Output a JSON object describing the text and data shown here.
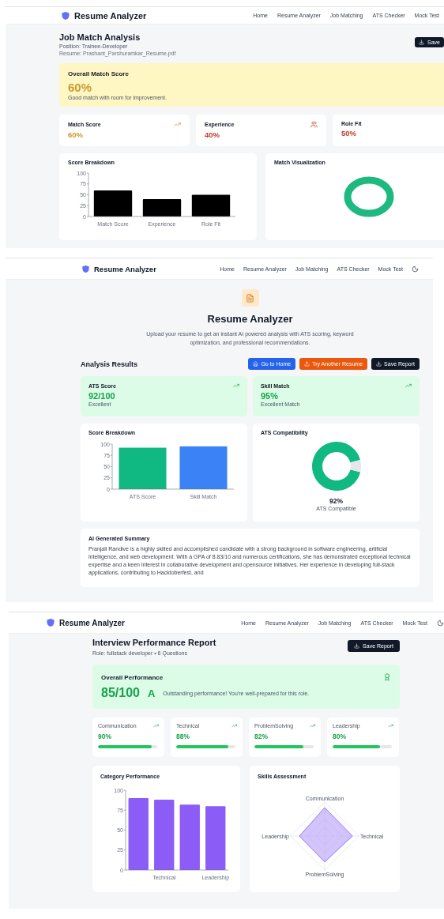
{
  "job_match_screen": {
    "app_name": "Resume Analyzer",
    "nav": [
      "Home",
      "Resume Analyzer",
      "Job Matching",
      "ATS Checker",
      "Mock Test"
    ],
    "title": "Job Match Analysis",
    "position": "Position: Trainee-Developer",
    "resume": "Resume: Prashant_Parshuramkar_Resume.pdf",
    "save_button": "Save",
    "overall": {
      "title": "Overall Match Score",
      "score": "60%",
      "description": "Good match with room for improvement."
    },
    "metrics": [
      {
        "label": "Match Score",
        "value": "60%",
        "color": "#c99a2e"
      },
      {
        "label": "Experience",
        "value": "40%",
        "color": "#c0392b"
      },
      {
        "label": "Role Fit",
        "value": "50%",
        "color": "#c0392b"
      }
    ],
    "breakdown": {
      "title": "Score Breakdown",
      "chart_data": {
        "type": "bar",
        "categories": [
          "Match Score",
          "Experience",
          "Role Fit"
        ],
        "values": [
          60,
          40,
          50
        ],
        "ylim": [
          0,
          100
        ],
        "yticks": [
          0,
          25,
          50,
          75,
          100
        ]
      }
    },
    "visualization": {
      "title": "Match Visualization"
    }
  },
  "resume_screen": {
    "app_name": "Resume Analyzer",
    "nav": [
      "Home",
      "Resume Analyzer",
      "Job Matching",
      "ATS Checker",
      "Mock Test"
    ],
    "title": "Resume Analyzer",
    "description": "Upload your resume to get an instant AI powered analysis with ATS scoring, keyword optimization, and professional recommendations.",
    "results_title": "Analysis Results",
    "buttons": [
      {
        "label": "Go to Home",
        "kind": "home"
      },
      {
        "label": "Try Another Resume",
        "kind": "upload"
      },
      {
        "label": "Save Report",
        "kind": "save"
      }
    ],
    "scores": [
      {
        "label": "ATS Score",
        "value": "92/100",
        "note": "Excellent"
      },
      {
        "label": "Skill Match",
        "value": "95%",
        "note": "Excellent Match"
      }
    ],
    "breakdown": {
      "title": "Score Breakdown",
      "chart_data": {
        "type": "bar",
        "categories": [
          "ATS Score",
          "Skill Match"
        ],
        "series": [
          {
            "color": "#10b981",
            "values": [
              92,
              null
            ]
          },
          {
            "color": "#3b82f6",
            "values": [
              null,
              95
            ]
          }
        ],
        "ylim": [
          0,
          100
        ],
        "yticks": [
          0,
          25,
          50,
          75,
          100
        ]
      }
    },
    "compatibility": {
      "title": "ATS Compatibility",
      "chart_data": {
        "type": "donut",
        "values": [
          92,
          8
        ]
      },
      "value": "92%",
      "label": "ATS Compatible"
    },
    "summary": {
      "title": "AI Generated Summary",
      "text": "Pranjali Randive is a highly skilled and accomplished candidate with a strong background in software engineering, artificial intelligence, and web development. With a GPA of 8.83/10 and numerous certifications, she has demonstrated exceptional technical expertise and a keen interest in collaborative development and opensource initiatives. Her experience in developing full-stack applications, contributing to Hacktoberfest, and"
    }
  },
  "interview_screen": {
    "app_name": "Resume Analyzer",
    "nav": [
      "Home",
      "Resume Analyzer",
      "Job Matching",
      "ATS Checker",
      "Mock Test"
    ],
    "title": "Interview Performance Report",
    "subtitle": "Role: fullstack developer • 6 Questions",
    "save_button": "Save Report",
    "overall": {
      "title": "Overall Performance",
      "score": "85/100",
      "grade": "A",
      "message": "Outstanding performance! You're well-prepared for this role."
    },
    "skills": [
      {
        "label": "Communication",
        "value": "90%",
        "level": 0.9
      },
      {
        "label": "Technical",
        "value": "88%",
        "level": 0.88
      },
      {
        "label": "ProblemSolving",
        "value": "82%",
        "level": 0.82
      },
      {
        "label": "Leadership",
        "value": "80%",
        "level": 0.8
      }
    ],
    "category": {
      "title": "Category Performance",
      "chart_data": {
        "type": "bar",
        "categories": [
          null,
          "Technical",
          null,
          "Leadership"
        ],
        "values": [
          90,
          88,
          82,
          80
        ],
        "ylim": [
          0,
          100
        ],
        "yticks": [
          0,
          25,
          50,
          75,
          100
        ]
      }
    },
    "assessment": {
      "title": "Skills Assessment",
      "axes": [
        "Communication",
        "Technical",
        "ProblemSolving",
        "Leadership"
      ]
    }
  }
}
